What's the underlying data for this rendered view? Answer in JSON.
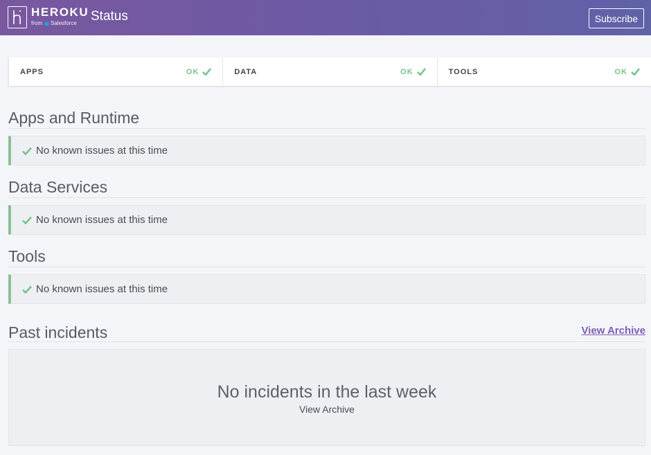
{
  "header": {
    "logo_word": "HEROKU",
    "logo_sub_from": "from",
    "logo_sub_brand": "Salesforce",
    "title": "Status",
    "subscribe_label": "Subscribe"
  },
  "summary": [
    {
      "label": "APPS",
      "status": "OK"
    },
    {
      "label": "DATA",
      "status": "OK"
    },
    {
      "label": "TOOLS",
      "status": "OK"
    }
  ],
  "sections": [
    {
      "title": "Apps and Runtime",
      "message": "No known issues at this time"
    },
    {
      "title": "Data Services",
      "message": "No known issues at this time"
    },
    {
      "title": "Tools",
      "message": "No known issues at this time"
    }
  ],
  "past_incidents": {
    "title": "Past incidents",
    "archive_link": "View Archive",
    "empty_message": "No incidents in the last week",
    "empty_archive_link": "View Archive"
  },
  "colors": {
    "header_gradient_start": "#79589f",
    "header_gradient_end": "#6062a8",
    "ok_green": "#74c48c",
    "status_border": "#8cbf94",
    "link_purple": "#7e60b3"
  },
  "icons": {
    "logo": "heroku-logo-icon",
    "ok": "checkmark-icon",
    "salesforce": "salesforce-cloud-icon"
  }
}
